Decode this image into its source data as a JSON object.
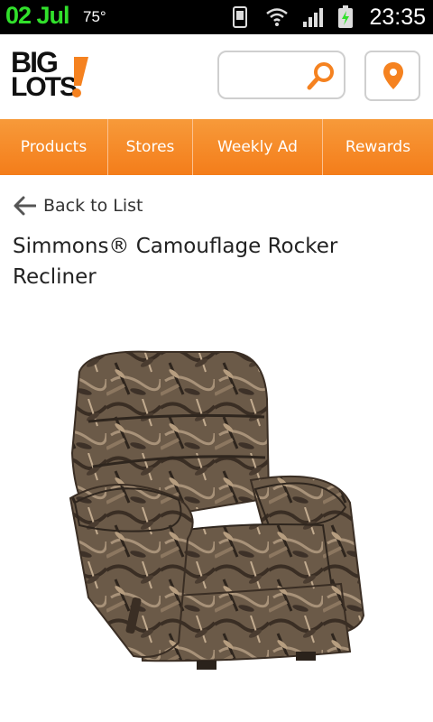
{
  "status_bar": {
    "date": "02 Jul",
    "temperature": "75°",
    "time": "23:35",
    "icons": [
      "screenshot-icon",
      "wifi-icon",
      "signal-icon",
      "battery-icon"
    ]
  },
  "header": {
    "logo_line1": "BIG",
    "logo_line2": "LOTS",
    "search_placeholder": "",
    "icons": [
      "search-icon",
      "location-pin-icon"
    ]
  },
  "nav": {
    "items": [
      {
        "label": "Products"
      },
      {
        "label": "Stores"
      },
      {
        "label": "Weekly Ad"
      },
      {
        "label": "Rewards"
      }
    ]
  },
  "page": {
    "back_label": "Back to List",
    "product_title": "Simmons® Camouflage Rocker Recliner",
    "product_image_subject": "camouflage-recliner-chair"
  },
  "colors": {
    "accent": "#f58220",
    "status_date": "#31e02b"
  }
}
